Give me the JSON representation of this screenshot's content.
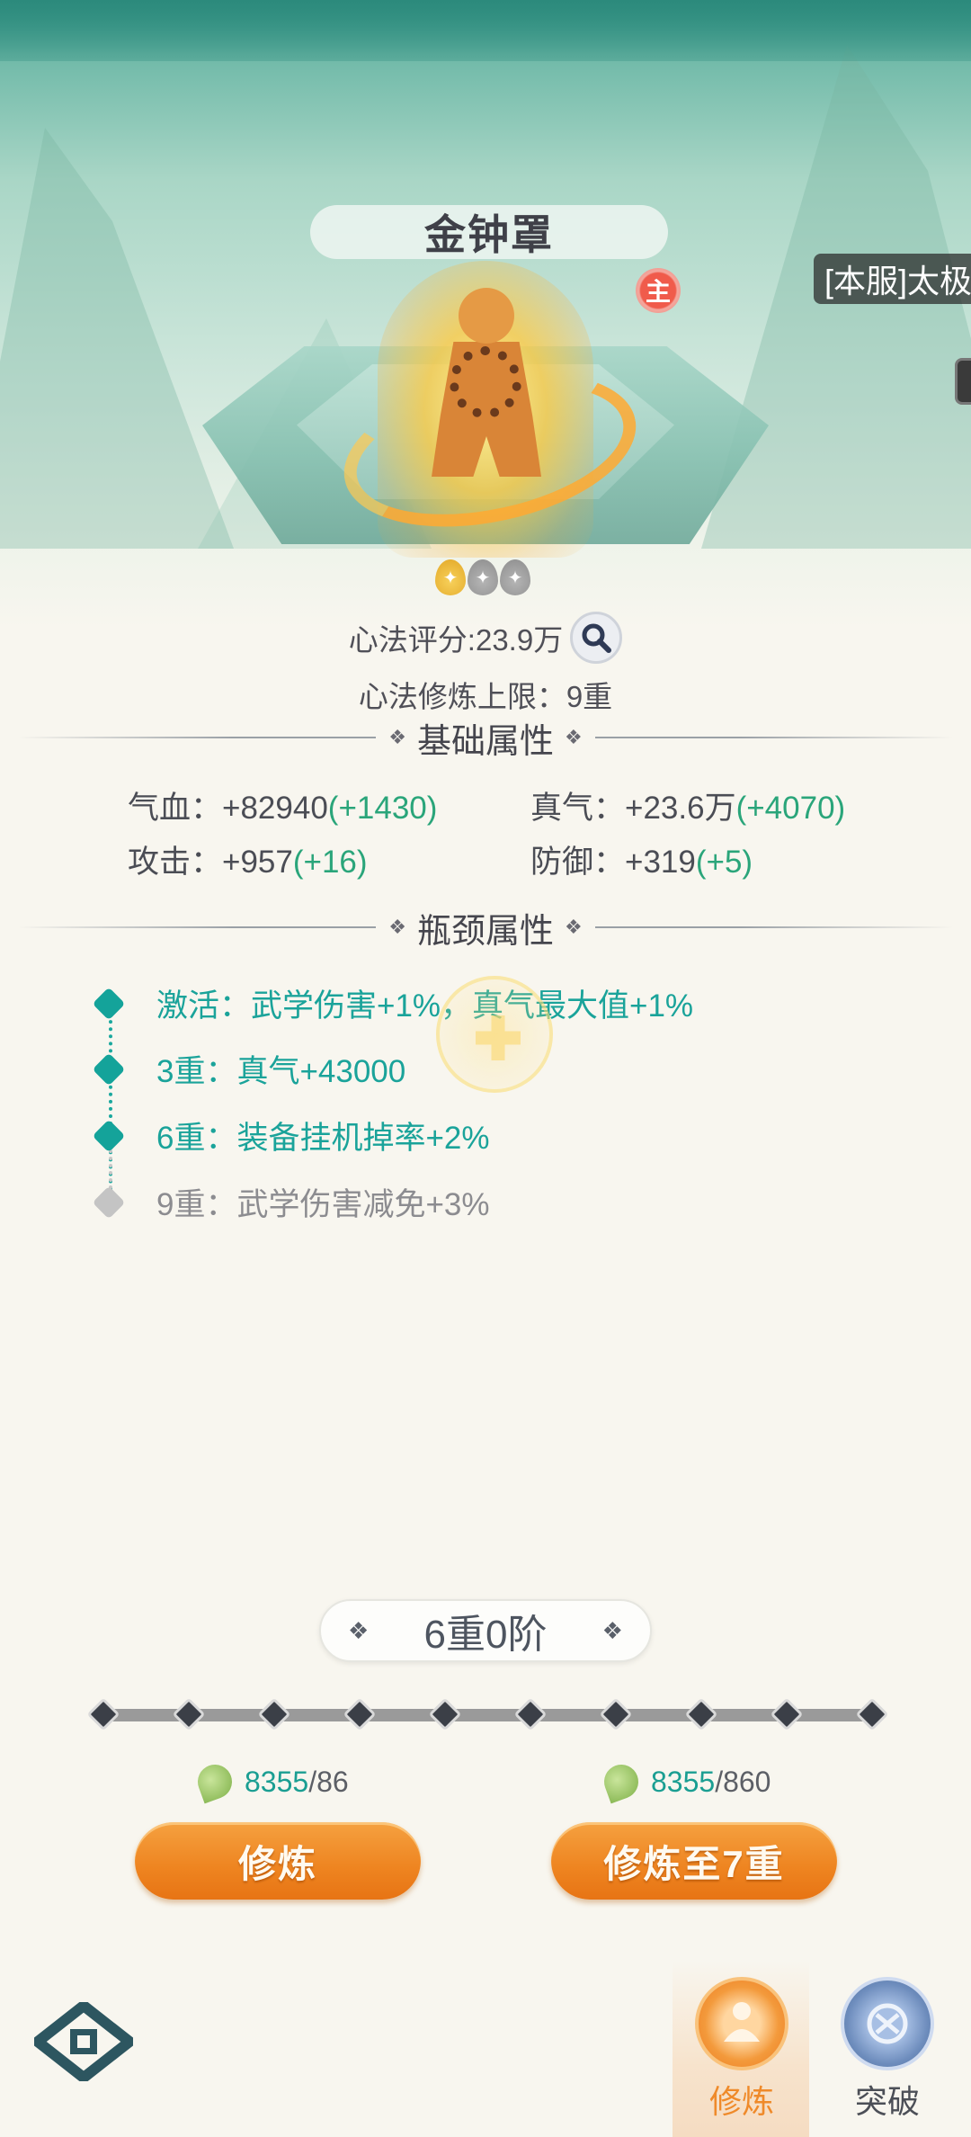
{
  "skill": {
    "title": "金钟罩",
    "main_badge": "主",
    "server_tag": "[本服]太极",
    "stars": {
      "filled": 1,
      "total": 3
    },
    "score_label": "心法评分:23.9万",
    "limit_label": "心法修炼上限：9重"
  },
  "base_section": {
    "title": "基础属性",
    "attrs": [
      {
        "label": "气血：",
        "value": "+82940",
        "bonus": "(+1430)"
      },
      {
        "label": "真气：",
        "value": "+23.6万",
        "bonus": "(+4070)"
      },
      {
        "label": "攻击：",
        "value": "+957",
        "bonus": "(+16)"
      },
      {
        "label": "防御：",
        "value": "+319",
        "bonus": "(+5)"
      }
    ]
  },
  "bottleneck_section": {
    "title": "瓶颈属性",
    "items": [
      {
        "text": "激活：武学伤害+1%，真气最大值+1%",
        "active": true
      },
      {
        "text": "3重：真气+43000",
        "active": true
      },
      {
        "text": "6重：装备挂机掉率+2%",
        "active": true
      },
      {
        "text": "9重：武学伤害减免+3%",
        "active": false
      }
    ]
  },
  "level": {
    "label": "6重0阶",
    "nodes_total": 10,
    "nodes_filled": 0
  },
  "actions": {
    "train": {
      "have": "8355",
      "cost": "/86",
      "label": "修炼"
    },
    "train_to": {
      "have": "8355",
      "cost": "/860",
      "label": "修炼至7重"
    }
  },
  "nav": {
    "items": [
      {
        "label": "修炼",
        "icon": "meditation-icon",
        "active": true
      },
      {
        "label": "突破",
        "icon": "breakthrough-icon",
        "active": false
      }
    ]
  },
  "colors": {
    "accent_green": "#2aa57a",
    "teal": "#1aa39a",
    "orange": "#ee8420"
  }
}
